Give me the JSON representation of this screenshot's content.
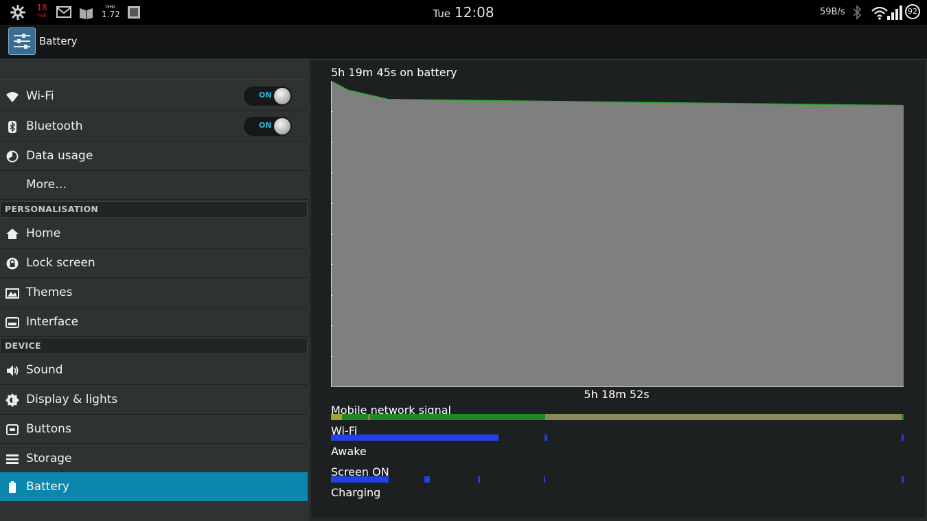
{
  "status_bar": {
    "notifications": [
      {
        "icon": "settings-cog-icon"
      },
      {
        "icon": "temperature-icon",
        "text_top": "18",
        "text_bottom": "mA"
      },
      {
        "icon": "mail-icon"
      },
      {
        "icon": "book-icon"
      },
      {
        "icon": "cpu-frequency-icon",
        "text_top": "GHz",
        "text_bottom": "1.72"
      },
      {
        "icon": "sd-card-icon"
      }
    ],
    "day": "Tue",
    "time": "12:08",
    "net_speed": "59B/s",
    "battery_level": "92",
    "right_icons": [
      "bluetooth-icon",
      "wifi-icon",
      "cell-signal-icon",
      "battery-circle-icon"
    ]
  },
  "action_bar": {
    "title": "Battery",
    "icon": "settings-icon"
  },
  "sidebar": {
    "items": [
      {
        "label": "Wi-Fi",
        "icon": "wifi-icon",
        "toggle": "ON"
      },
      {
        "label": "Bluetooth",
        "icon": "bluetooth-icon",
        "toggle": "ON"
      },
      {
        "label": "Data usage",
        "icon": "data-usage-icon"
      },
      {
        "label": "More…"
      }
    ],
    "sections": [
      {
        "header": "PERSONALISATION",
        "items": [
          {
            "label": "Home",
            "icon": "home-icon"
          },
          {
            "label": "Lock screen",
            "icon": "lock-icon"
          },
          {
            "label": "Themes",
            "icon": "themes-icon"
          },
          {
            "label": "Interface",
            "icon": "interface-icon"
          }
        ]
      },
      {
        "header": "DEVICE",
        "items": [
          {
            "label": "Sound",
            "icon": "speaker-icon"
          },
          {
            "label": "Display & lights",
            "icon": "brightness-icon"
          },
          {
            "label": "Buttons",
            "icon": "buttons-icon"
          },
          {
            "label": "Storage",
            "icon": "storage-icon"
          },
          {
            "label": "Battery",
            "icon": "battery-icon",
            "selected": true
          }
        ]
      }
    ]
  },
  "battery": {
    "on_battery": "5h 19m 45s on battery",
    "graph_duration": "5h 18m 52s",
    "graph_fill_color": "#7f7f7f",
    "graph_line_color": "#2fa82f",
    "level_curve_percent": [
      [
        0,
        100
      ],
      [
        0.03,
        97
      ],
      [
        0.1,
        94
      ],
      [
        1,
        92
      ]
    ],
    "signals": [
      {
        "label": "Mobile network signal",
        "color": "#1f8a1f",
        "secondary_color": "#8a8a5e"
      },
      {
        "label": "Wi-Fi",
        "color": "#2340e6"
      },
      {
        "label": "Awake"
      },
      {
        "label": "Screen ON",
        "color": "#2340e6"
      },
      {
        "label": "Charging"
      }
    ]
  }
}
